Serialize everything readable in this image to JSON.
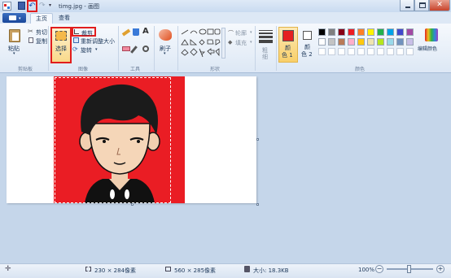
{
  "window": {
    "title": "timg.jpg - 画图"
  },
  "tabs": [
    {
      "label": "主页"
    },
    {
      "label": "查看"
    }
  ],
  "ribbon": {
    "clipboard": {
      "paste": "粘贴",
      "cut": "剪切",
      "copy": "复制",
      "group": "剪贴板"
    },
    "image": {
      "select": "选择",
      "crop": "裁剪",
      "resize": "重新调整大小",
      "rotate": "旋转",
      "group": "图像"
    },
    "tools": {
      "group": "工具"
    },
    "brushes": {
      "label": "刷子"
    },
    "shapes": {
      "outline": "轮廓",
      "fill": "填充",
      "group": "形状"
    },
    "size": {
      "label": "粗细"
    },
    "colors": {
      "color1": "颜\n色 1",
      "color1_a": "颜",
      "color1_b": "色 1",
      "color2_a": "颜",
      "color2_b": "色 2",
      "edit": "编辑颜色",
      "group": "颜色",
      "color1_value": "#e52020",
      "palette_row1": [
        "#000000",
        "#7f7f7f",
        "#880015",
        "#ed1c24",
        "#ff7f27",
        "#fff200",
        "#22b14c",
        "#00a2e8",
        "#3f48cc",
        "#a349a4"
      ],
      "palette_row2": [
        "#ffffff",
        "#c3c3c3",
        "#b97a57",
        "#ffaec9",
        "#ffc90e",
        "#efe4b0",
        "#b5e61d",
        "#99d9ea",
        "#7092be",
        "#c8bfe7"
      ]
    }
  },
  "status": {
    "selection_size": "230 × 284像素",
    "image_size": "560 × 285像素",
    "file_size": "大小: 18.3KB",
    "zoom": "100%"
  }
}
